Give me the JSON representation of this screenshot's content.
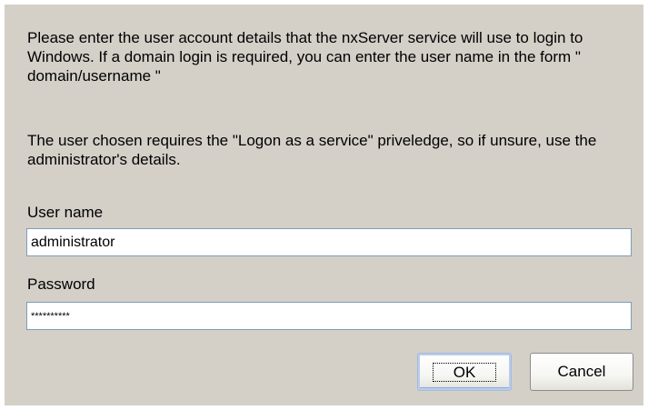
{
  "dialog": {
    "intro_text": "Please enter the user account details that the nxServer service will use to login to Windows. If a domain login is required, you can enter the user name in the form \" domain/username \"",
    "note_text": "The user chosen requires the \"Logon as a service\" priveledge, so if unsure, use the administrator's details.",
    "username_label": "User name",
    "username_value": "administrator",
    "password_label": "Password",
    "password_mask": "**********",
    "ok_label": "OK",
    "cancel_label": "Cancel"
  },
  "colors": {
    "dialog_background": "#d4d0c8",
    "field_border": "#7f9db9",
    "button_border": "#003c74"
  }
}
